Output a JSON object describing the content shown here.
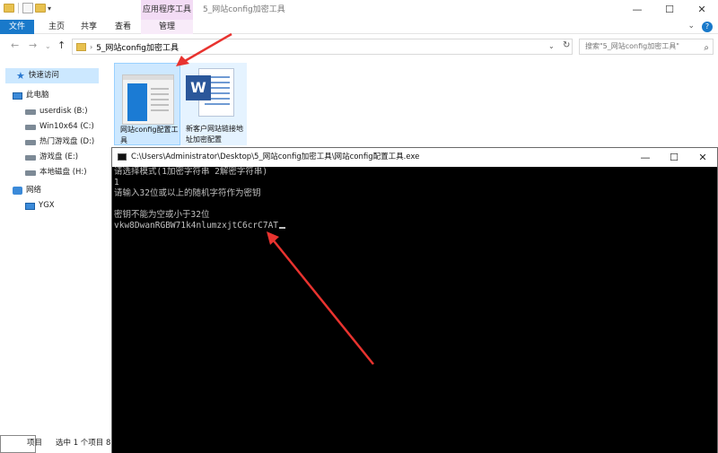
{
  "explorer": {
    "context_tab_group": "应用程序工具",
    "window_title": "5_网站config加密工具",
    "tabs": {
      "file": "文件",
      "home": "主页",
      "share": "共享",
      "view": "查看",
      "manage": "管理"
    },
    "address": {
      "path": "5_网站config加密工具",
      "search_placeholder": "搜索\"5_网站config加密工具\""
    },
    "nav": {
      "quick_access": "快速访问",
      "this_pc": "此电脑",
      "drives": [
        "userdisk (B:)",
        "Win10x64 (C:)",
        "热门游戏盘 (D:)",
        "游戏盘 (E:)",
        "本地磁盘 (H:)"
      ],
      "network": "网络",
      "network_item": "YGX"
    },
    "files": [
      {
        "name": "网站config配置工具"
      },
      {
        "name": "新客户网站链接地址加密配置"
      }
    ],
    "status": {
      "items": "项目",
      "selected": "选中 1 个项目  8"
    }
  },
  "console": {
    "title": "C:\\Users\\Administrator\\Desktop\\5_网站config加密工具\\网站config配置工具.exe",
    "lines": [
      "请选择模式(1加密字符串 2解密字符串)",
      "1",
      "请输入32位或以上的随机字符作为密钥",
      "",
      "密钥不能为空或小于32位",
      "vkw8DwanRGBW71k4nlumzxjtC6crC7AT"
    ]
  },
  "colors": {
    "file_tab": "#1979ca",
    "annotation_arrow": "#e8332f",
    "console_bg": "#000000",
    "console_text": "#c0c0c0"
  }
}
